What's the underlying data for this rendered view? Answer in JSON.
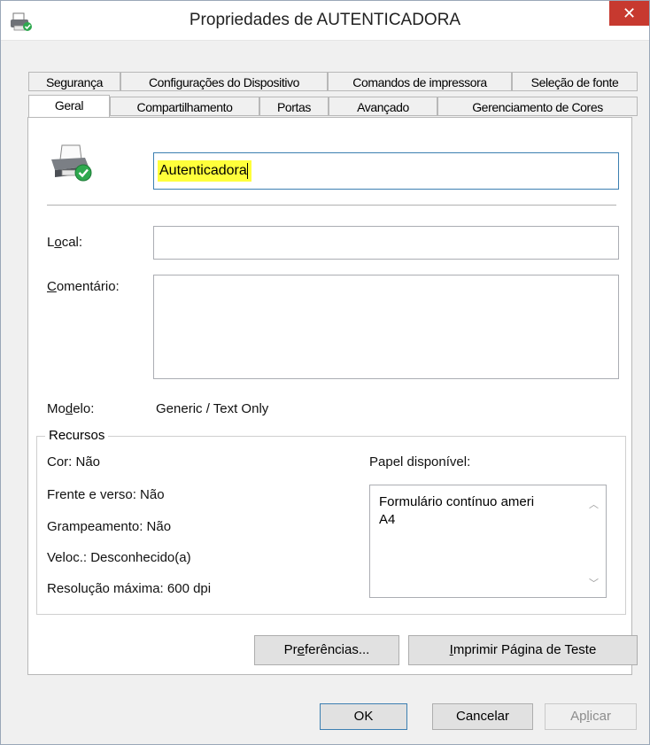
{
  "window": {
    "title": "Propriedades de AUTENTICADORA",
    "close_glyph": "✕"
  },
  "tabs_row1": [
    {
      "label": "Segurança"
    },
    {
      "label": "Configurações do Dispositivo"
    },
    {
      "label": "Comandos de impressora"
    },
    {
      "label": "Seleção de fonte"
    }
  ],
  "tabs_row2": [
    {
      "label": "Geral",
      "selected": true
    },
    {
      "label": "Compartilhamento"
    },
    {
      "label": "Portas"
    },
    {
      "label": "Avançado"
    },
    {
      "label": "Gerenciamento de Cores"
    }
  ],
  "general": {
    "printer_name": "Autenticadora",
    "location_label_pre": "L",
    "location_label_ul": "o",
    "location_label_post": "cal:",
    "location_value": "",
    "comment_label_ul": "C",
    "comment_label_post": "omentário:",
    "comment_value": "",
    "model_label_pre": "Mo",
    "model_label_ul": "d",
    "model_label_post": "elo:",
    "model_value": "Generic / Text Only"
  },
  "features": {
    "group_title": "Recursos",
    "color": "Cor: Não",
    "duplex": "Frente e verso: Não",
    "staple": "Grampeamento: Não",
    "speed": "Veloc.: Desconhecido(a)",
    "max_resolution": "Resolução máxima: 600 dpi",
    "paper_label": "Papel disponível:",
    "paper_list": [
      "Formulário contínuo ameri",
      "A4"
    ]
  },
  "buttons": {
    "preferences_pre": "Pr",
    "preferences_ul": "e",
    "preferences_post": "ferências...",
    "test_page_ul": "I",
    "test_page_post": "mprimir Página de Teste",
    "ok": "OK",
    "cancel": "Cancelar",
    "apply_pre": "Ap",
    "apply_ul": "l",
    "apply_post": "icar"
  },
  "colors": {
    "highlight": "#ffff3b",
    "close_red": "#c7392f",
    "accent_border": "#3c7fb1"
  }
}
